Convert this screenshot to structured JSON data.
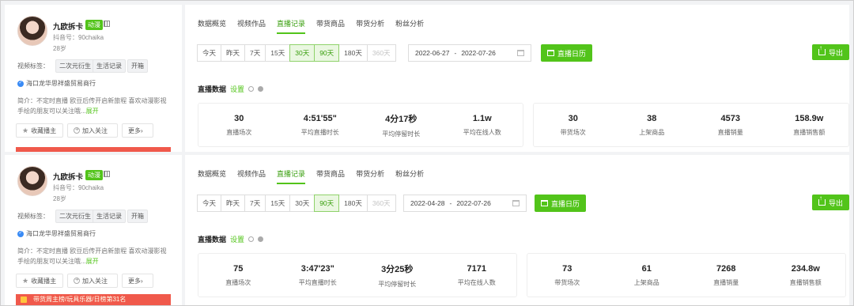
{
  "colors": {
    "accent": "#52c41a",
    "red": "#f0594b"
  },
  "panels": [
    {
      "profile": {
        "name": "九欧拆卡",
        "badge": "动漫",
        "id": "抖音号：90chaika",
        "age": "28岁",
        "tags_label": "视频标签：",
        "tags": [
          "二次元衍生",
          "生活记录",
          "开箱"
        ],
        "company": "海口龙华思祥盛贸易商行",
        "bio": "简介：不定时直播 欧豆后传开启新旅程 喜欢动漫影视手绘的朋友可以关注哦...",
        "bio_more": "展开",
        "btn_fav": "收藏播主",
        "btn_follow": "加入关注",
        "btn_more": "更多›",
        "strip_text": ""
      },
      "tabs": [
        "数据概览",
        "视频作品",
        "直播记录",
        "带货商品",
        "带货分析",
        "粉丝分析"
      ],
      "range_buttons": [
        "今天",
        "昨天",
        "7天",
        "15天",
        "30天",
        "90天",
        "180天",
        "360天"
      ],
      "date_start": "2022-06-27",
      "date_sep": "-",
      "date_end": "2022-07-26",
      "calendar_label": "直播日历",
      "export_label": "导出",
      "section_title": "直播数据",
      "section_setting": "设置",
      "stats_left": [
        {
          "value": "30",
          "label": "直播场次"
        },
        {
          "value": "4:51'55\"",
          "label": "平均直播时长"
        },
        {
          "value": "4分17秒",
          "label": "平均停留时长"
        },
        {
          "value": "1.1w",
          "label": "平均在线人数"
        }
      ],
      "stats_right": [
        {
          "value": "30",
          "label": "带货场次"
        },
        {
          "value": "38",
          "label": "上架商品"
        },
        {
          "value": "4573",
          "label": "直播销量"
        },
        {
          "value": "158.9w",
          "label": "直播销售额"
        }
      ]
    },
    {
      "profile": {
        "name": "九欧拆卡",
        "badge": "动漫",
        "id": "抖音号：90chaika",
        "age": "28岁",
        "tags_label": "视频标签：",
        "tags": [
          "二次元衍生",
          "生活记录",
          "开箱"
        ],
        "company": "海口龙华思祥盛贸易商行",
        "bio": "简介：不定时直播 欧豆后传开启新旅程 喜欢动漫影视手绘的朋友可以关注哦...",
        "bio_more": "展开",
        "btn_fav": "收藏播主",
        "btn_follow": "加入关注",
        "btn_more": "更多›",
        "strip_text": "带货周主榜/玩具乐器/日榜第31名"
      },
      "tabs": [
        "数据概览",
        "视频作品",
        "直播记录",
        "带货商品",
        "带货分析",
        "粉丝分析"
      ],
      "range_buttons": [
        "今天",
        "昨天",
        "7天",
        "15天",
        "30天",
        "90天",
        "180天",
        "360天"
      ],
      "date_start": "2022-04-28",
      "date_sep": "-",
      "date_end": "2022-07-26",
      "calendar_label": "直播日历",
      "export_label": "导出",
      "section_title": "直播数据",
      "section_setting": "设置",
      "stats_left": [
        {
          "value": "75",
          "label": "直播场次"
        },
        {
          "value": "3:47'23\"",
          "label": "平均直播时长"
        },
        {
          "value": "3分25秒",
          "label": "平均停留时长"
        },
        {
          "value": "7171",
          "label": "平均在线人数"
        }
      ],
      "stats_right": [
        {
          "value": "73",
          "label": "带货场次"
        },
        {
          "value": "61",
          "label": "上架商品"
        },
        {
          "value": "7268",
          "label": "直播销量"
        },
        {
          "value": "234.8w",
          "label": "直播销售额"
        }
      ]
    }
  ]
}
